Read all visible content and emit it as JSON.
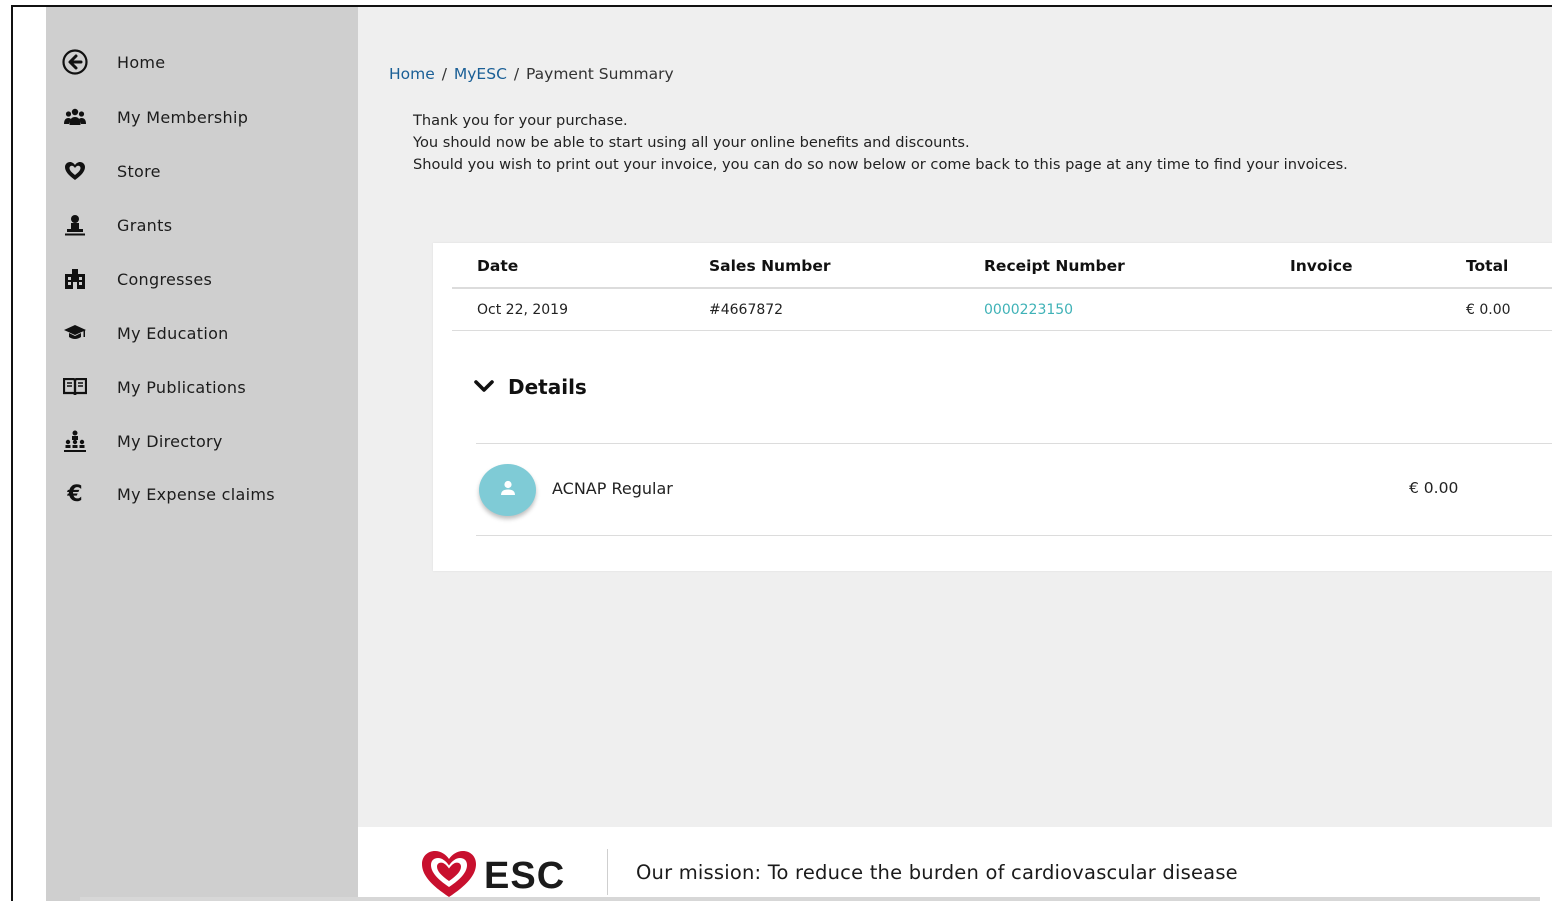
{
  "sidebar": {
    "items": [
      {
        "label": "Home",
        "icon": "back-arrow-circle-icon"
      },
      {
        "label": "My Membership",
        "icon": "users-icon"
      },
      {
        "label": "Store",
        "icon": "heart-icon"
      },
      {
        "label": "Grants",
        "icon": "person-stamp-icon"
      },
      {
        "label": "Congresses",
        "icon": "building-icon"
      },
      {
        "label": "My Education",
        "icon": "graduation-cap-icon"
      },
      {
        "label": "My Publications",
        "icon": "book-icon"
      },
      {
        "label": "My Directory",
        "icon": "sitemap-icon"
      },
      {
        "label": "My Expense claims",
        "icon": "euro-icon"
      }
    ]
  },
  "breadcrumb": {
    "home": "Home",
    "myesc": "MyESC",
    "current": "Payment Summary",
    "separator": "/"
  },
  "intro": {
    "line1": "Thank you for your purchase.",
    "line2": "You should now be able to start using all your online benefits and discounts.",
    "line3": "Should you wish to print out your invoice, you can do so now below or come back to this page at any time to find your invoices."
  },
  "table": {
    "headers": {
      "date": "Date",
      "sales_number": "Sales Number",
      "receipt_number": "Receipt Number",
      "invoice": "Invoice",
      "total": "Total"
    },
    "row": {
      "date": "Oct 22, 2019",
      "sales_number": "#4667872",
      "receipt_number": "0000223150",
      "invoice": "",
      "total": "€ 0.00"
    }
  },
  "details": {
    "label": "Details",
    "item": {
      "name": "ACNAP Regular",
      "price": "€ 0.00"
    }
  },
  "footer": {
    "logo_text": "ESC",
    "mission": "Our mission: To reduce the burden of cardiovascular disease"
  },
  "colors": {
    "sidebar_bg": "#cfcfcf",
    "page_bg": "#efefef",
    "link": "#1a5f96",
    "teal_link": "#3fb2b7",
    "avatar": "#7fcbd6",
    "logo_red": "#c8102e"
  }
}
